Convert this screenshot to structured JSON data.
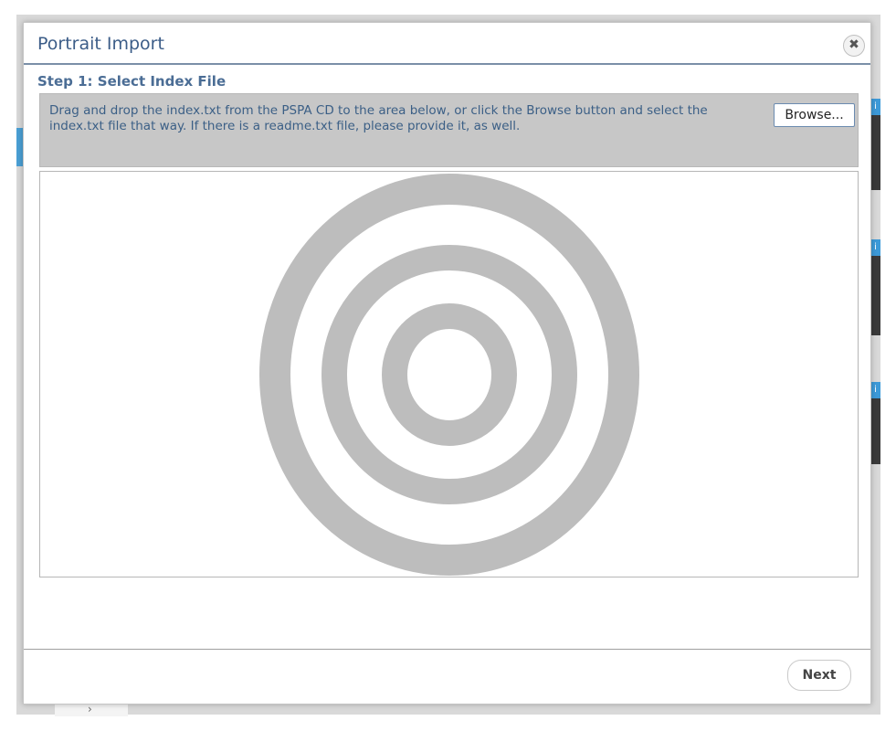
{
  "dialog": {
    "title": "Portrait Import",
    "close_icon": "close-icon",
    "step_title": "Step 1: Select Index File",
    "instructions": "Drag and drop the index.txt from the PSPA CD to the area below, or click the Browse button and select the index.txt file that way. If there is a readme.txt file, please provide it, as well.",
    "browse_label": "Browse...",
    "drop_zone_icon": "target-icon",
    "next_label": "Next"
  },
  "background": {
    "bottom_tab_glyph": "›",
    "thumb_cap_glyph": "i"
  },
  "colors": {
    "title": "#3c5d88",
    "step_title": "#4b6d95",
    "instruction_text": "#3b5f86",
    "instruction_bg": "#c7c7c7",
    "target_rings": "#bdbdbd"
  }
}
